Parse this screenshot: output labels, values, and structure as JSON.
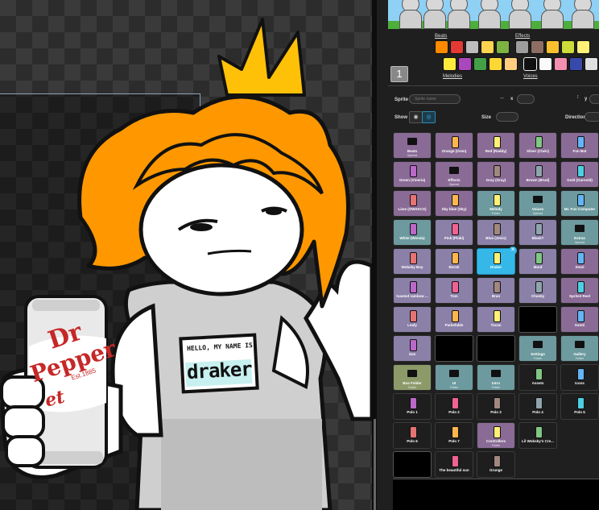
{
  "header": {
    "page_number": "1",
    "categories": {
      "beats": "Beats",
      "effects": "Effects",
      "melodies": "Melodies",
      "voices": "Voices"
    }
  },
  "badge": {
    "line1": "HELLO, MY NAME IS",
    "line2": "draker"
  },
  "can": {
    "brand_dr": "Dr",
    "brand_pepper": "Pepper",
    "est": "Est.1885",
    "diet": "et"
  },
  "controls": {
    "sprite_label": "Sprite",
    "sprite_value": "Sprite name",
    "x_label": "x",
    "y_label": "y",
    "show_label": "Show",
    "size_label": "Size",
    "direction_label": "Direction"
  },
  "colors": {
    "accent_selected": "#35b8e8",
    "hair": "#ff9800",
    "crown": "#ffc107"
  },
  "sprites": [
    {
      "name": "Beats",
      "sub": "Opened",
      "style": "c-purple",
      "icon": "folder-icon"
    },
    {
      "name": "Orange (Oren)",
      "sub": "",
      "style": "c-purple",
      "icon": "character-icon"
    },
    {
      "name": "Red (Raddy)",
      "sub": "",
      "style": "c-purple",
      "icon": "character-icon"
    },
    {
      "name": "Silver (Clukr)",
      "sub": "",
      "style": "c-purple",
      "icon": "character-icon"
    },
    {
      "name": "Fun Bot",
      "sub": "",
      "style": "c-purple",
      "icon": "character-icon"
    },
    {
      "name": "Green (Vineria)",
      "sub": "",
      "style": "c-purple",
      "icon": "character-icon"
    },
    {
      "name": "Effects",
      "sub": "Opened",
      "style": "c-purple",
      "icon": "folder-icon"
    },
    {
      "name": "Gray (Gray)",
      "sub": "",
      "style": "c-purple",
      "icon": "character-icon"
    },
    {
      "name": "Brown (Brud)",
      "sub": "",
      "style": "c-purple",
      "icon": "character-icon"
    },
    {
      "name": "Gold (Garnold)",
      "sub": "",
      "style": "c-purple",
      "icon": "character-icon"
    },
    {
      "name": "Lime (OWAKCX)",
      "sub": "",
      "style": "c-purple",
      "icon": "character-icon"
    },
    {
      "name": "Sky blue (Sky)",
      "sub": "",
      "style": "c-purple",
      "icon": "character-icon"
    },
    {
      "name": "Melody",
      "sub": "Folder",
      "style": "c-teal",
      "icon": "character-icon"
    },
    {
      "name": "Voices",
      "sub": "Opened",
      "style": "c-teal",
      "icon": "folder-icon"
    },
    {
      "name": "Mr. Fun Computer",
      "sub": "",
      "style": "c-teal",
      "icon": "character-icon"
    },
    {
      "name": "White (Wenda)",
      "sub": "",
      "style": "c-teal",
      "icon": "character-icon"
    },
    {
      "name": "Pink (Pinki)",
      "sub": "",
      "style": "c-lav",
      "icon": "character-icon"
    },
    {
      "name": "Blue (Jevin)",
      "sub": "",
      "style": "c-lav",
      "icon": "character-icon"
    },
    {
      "name": "Black?",
      "sub": "",
      "style": "c-lav",
      "icon": "character-icon"
    },
    {
      "name": "Extras",
      "sub": "Opened",
      "style": "c-teal",
      "icon": "folder-icon"
    },
    {
      "name": "Wobsky Boy",
      "sub": "",
      "style": "c-lav",
      "icon": "character-icon"
    },
    {
      "name": "Borok",
      "sub": "",
      "style": "c-lav",
      "icon": "character-icon"
    },
    {
      "name": "Draker",
      "sub": "",
      "style": "c-sel",
      "icon": "character-icon"
    },
    {
      "name": "Mard",
      "sub": "",
      "style": "c-lav",
      "icon": "character-icon"
    },
    {
      "name": "Smol",
      "sub": "",
      "style": "c-purple",
      "icon": "character-icon"
    },
    {
      "name": "toasted rainbow ...",
      "sub": "",
      "style": "c-lav",
      "icon": "character-icon"
    },
    {
      "name": "Tom",
      "sub": "",
      "style": "c-lav",
      "icon": "character-icon"
    },
    {
      "name": "Bran",
      "sub": "",
      "style": "c-lav",
      "icon": "character-icon"
    },
    {
      "name": "Chunky",
      "sub": "",
      "style": "c-lav",
      "icon": "character-icon"
    },
    {
      "name": "Sprite3 Reel",
      "sub": "",
      "style": "c-purple",
      "icon": "character-icon"
    },
    {
      "name": "Leafy",
      "sub": "",
      "style": "c-lav",
      "icon": "character-icon"
    },
    {
      "name": "Parkefable",
      "sub": "",
      "style": "c-lav",
      "icon": "character-icon"
    },
    {
      "name": "Tucan",
      "sub": "",
      "style": "c-lav",
      "icon": "character-icon"
    },
    {
      "name": "",
      "sub": "",
      "style": "c-black",
      "icon": "blank-icon"
    },
    {
      "name": "Somti",
      "sub": "",
      "style": "c-purple",
      "icon": "character-icon"
    },
    {
      "name": "Sun",
      "sub": "",
      "style": "c-lav",
      "icon": "character-icon"
    },
    {
      "name": "",
      "sub": "",
      "style": "c-black",
      "icon": "blank-icon"
    },
    {
      "name": "",
      "sub": "",
      "style": "c-black",
      "icon": "blank-icon"
    },
    {
      "name": "Settings",
      "sub": "Folder",
      "style": "c-teal",
      "icon": "folder-icon"
    },
    {
      "name": "Gallery",
      "sub": "Folder",
      "style": "c-teal",
      "icon": "folder-icon"
    },
    {
      "name": "Bos Folder",
      "sub": "Folder",
      "style": "c-olive",
      "icon": "folder-icon"
    },
    {
      "name": "UI",
      "sub": "Folder",
      "style": "c-teal",
      "icon": "folder-icon"
    },
    {
      "name": "Intro",
      "sub": "Folder",
      "style": "c-teal",
      "icon": "folder-icon"
    },
    {
      "name": "Assets",
      "sub": "",
      "style": "c-dark",
      "icon": "character-icon"
    },
    {
      "name": "Icons",
      "sub": "",
      "style": "c-dark",
      "icon": "character-icon"
    },
    {
      "name": "Polo 1",
      "sub": "",
      "style": "c-dark",
      "icon": "character-icon"
    },
    {
      "name": "Polo 2",
      "sub": "",
      "style": "c-dark",
      "icon": "character-icon"
    },
    {
      "name": "Polo 3",
      "sub": "",
      "style": "c-dark",
      "icon": "character-icon"
    },
    {
      "name": "Polo 4",
      "sub": "",
      "style": "c-dark",
      "icon": "character-icon"
    },
    {
      "name": "Polo 5",
      "sub": "",
      "style": "c-dark",
      "icon": "character-icon"
    },
    {
      "name": "Polo 6",
      "sub": "",
      "style": "c-dark",
      "icon": "character-icon"
    },
    {
      "name": "Polo 7",
      "sub": "",
      "style": "c-dark",
      "icon": "character-icon"
    },
    {
      "name": "Controllers",
      "sub": "Folder",
      "style": "c-purple",
      "icon": "character-icon"
    },
    {
      "name": "Lil Wobsky's Cre...",
      "sub": "",
      "style": "c-dark",
      "icon": "character-icon"
    },
    {
      "name": "",
      "sub": "",
      "style": "c-empty",
      "icon": "blank-icon"
    },
    {
      "name": "",
      "sub": "",
      "style": "c-black",
      "icon": "blank-icon"
    },
    {
      "name": "The beautiful sun",
      "sub": "",
      "style": "c-dark",
      "icon": "character-icon"
    },
    {
      "name": "Grunge",
      "sub": "",
      "style": "c-dark",
      "icon": "character-icon"
    }
  ]
}
